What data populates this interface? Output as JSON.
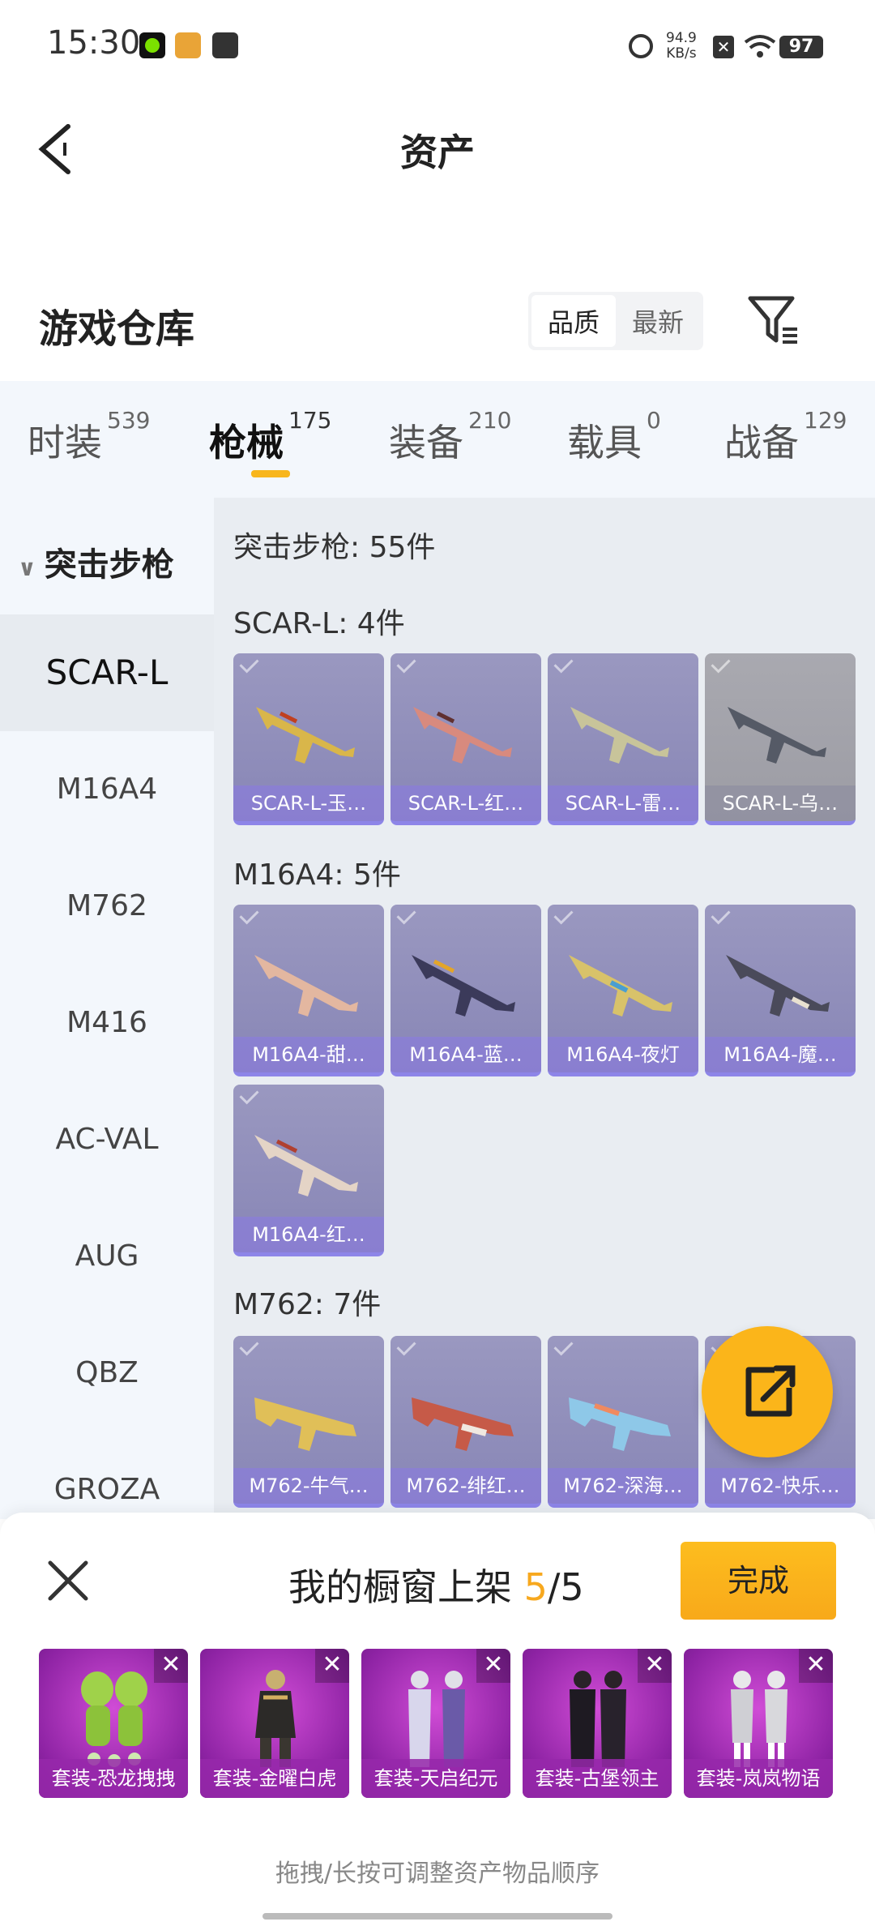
{
  "status": {
    "time": "15:30",
    "net_speed_value": "94.9",
    "net_speed_unit": "KB/s",
    "battery": "97"
  },
  "header": {
    "title": "资产"
  },
  "warehouse": {
    "title": "游戏仓库",
    "sort_quality": "品质",
    "sort_newest": "最新"
  },
  "tabs": [
    {
      "label": "时装",
      "count": "539"
    },
    {
      "label": "枪械",
      "count": "175"
    },
    {
      "label": "装备",
      "count": "210"
    },
    {
      "label": "载具",
      "count": "0"
    },
    {
      "label": "战备",
      "count": "129"
    }
  ],
  "sidebar": {
    "category": "突击步枪",
    "items": [
      "SCAR-L",
      "M16A4",
      "M762",
      "M416",
      "AC-VAL",
      "AUG",
      "QBZ",
      "GROZA"
    ]
  },
  "main": {
    "summary": "突击步枪: 55件",
    "groups": [
      {
        "title": "SCAR-L: 4件",
        "items": [
          "SCAR-L-玉…",
          "SCAR-L-红…",
          "SCAR-L-雷…",
          "SCAR-L-乌…"
        ]
      },
      {
        "title": "M16A4: 5件",
        "items": [
          "M16A4-甜…",
          "M16A4-蓝…",
          "M16A4-夜灯",
          "M16A4-魔…",
          "M16A4-红…"
        ]
      },
      {
        "title": "M762: 7件",
        "items": [
          "M762-牛气…",
          "M762-绯红…",
          "M762-深海…",
          "M762-快乐…"
        ]
      }
    ]
  },
  "sheet": {
    "title_prefix": "我的橱窗上架",
    "current": "5",
    "total": "/5",
    "done": "完成",
    "slots": [
      "套装-恐龙拽拽",
      "套装-金曜白虎",
      "套装-天启纪元",
      "套装-古堡领主",
      "套装-岚岚物语"
    ],
    "hint": "拖拽/长按可调整资产物品顺序"
  },
  "colors": {
    "accent": "#f8b61c",
    "card": "#8886b6",
    "slot": "#a42cbc"
  }
}
